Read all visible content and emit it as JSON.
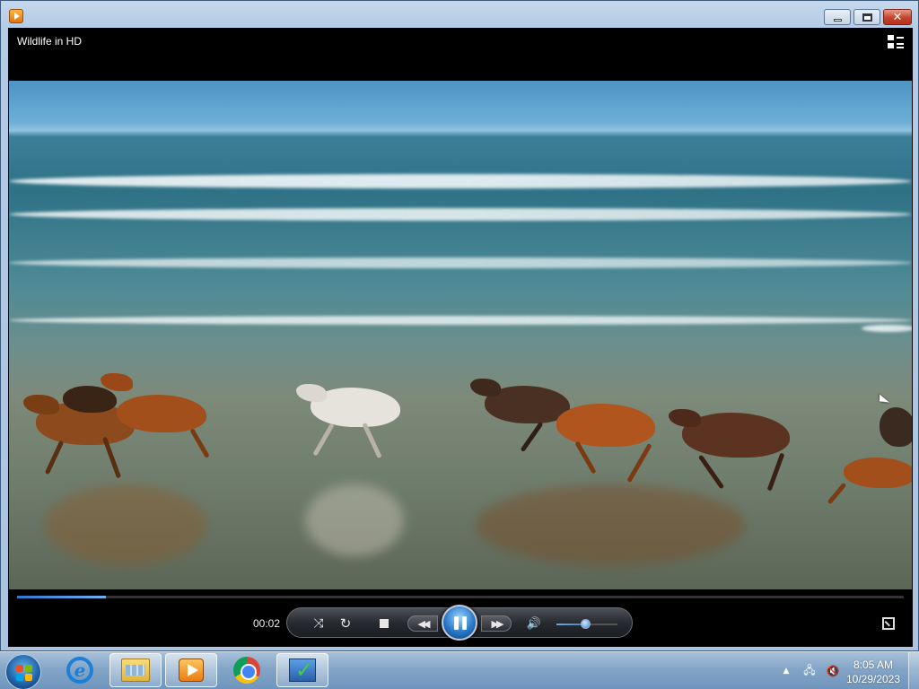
{
  "window": {
    "app_icon": "media-player-icon",
    "caption_buttons": {
      "minimize": "minimize-icon",
      "maximize": "maximize-icon",
      "close": "close-icon"
    }
  },
  "player": {
    "media_title": "Wildlife in HD",
    "switch_to_library_icon": "grid-icon",
    "video_scene": "horses-running-on-beach",
    "playback_progress": 0.1,
    "elapsed_time": "00:02",
    "state": "playing",
    "controls": {
      "shuffle": "shuffle-icon",
      "repeat": "repeat-icon",
      "stop": "stop-icon",
      "previous": "previous-icon",
      "play_pause": "pause-icon",
      "next": "next-icon",
      "mute": "speaker-icon",
      "fullscreen": "fullscreen-icon"
    },
    "volume": 0.5,
    "accent_color": "#2d7ad0"
  },
  "taskbar": {
    "start": "windows-logo-icon",
    "pinned": [
      {
        "name": "Internet Explorer",
        "icon": "ie-icon",
        "active": false
      },
      {
        "name": "Windows Explorer",
        "icon": "folder-icon",
        "active": true
      },
      {
        "name": "Windows Media Player",
        "icon": "media-player-icon",
        "active": true
      },
      {
        "name": "Google Chrome",
        "icon": "chrome-icon",
        "active": false
      },
      {
        "name": "Task app",
        "icon": "checklist-icon",
        "active": true
      }
    ],
    "tray": {
      "icons": [
        "show-hidden-icons-arrow",
        "network-icon",
        "speaker-muted-icon"
      ],
      "up_arrow": "▲",
      "network_glyph": "🖧",
      "speaker_glyph": "🔇",
      "time": "8:05 AM",
      "date": "10/29/2023"
    }
  }
}
